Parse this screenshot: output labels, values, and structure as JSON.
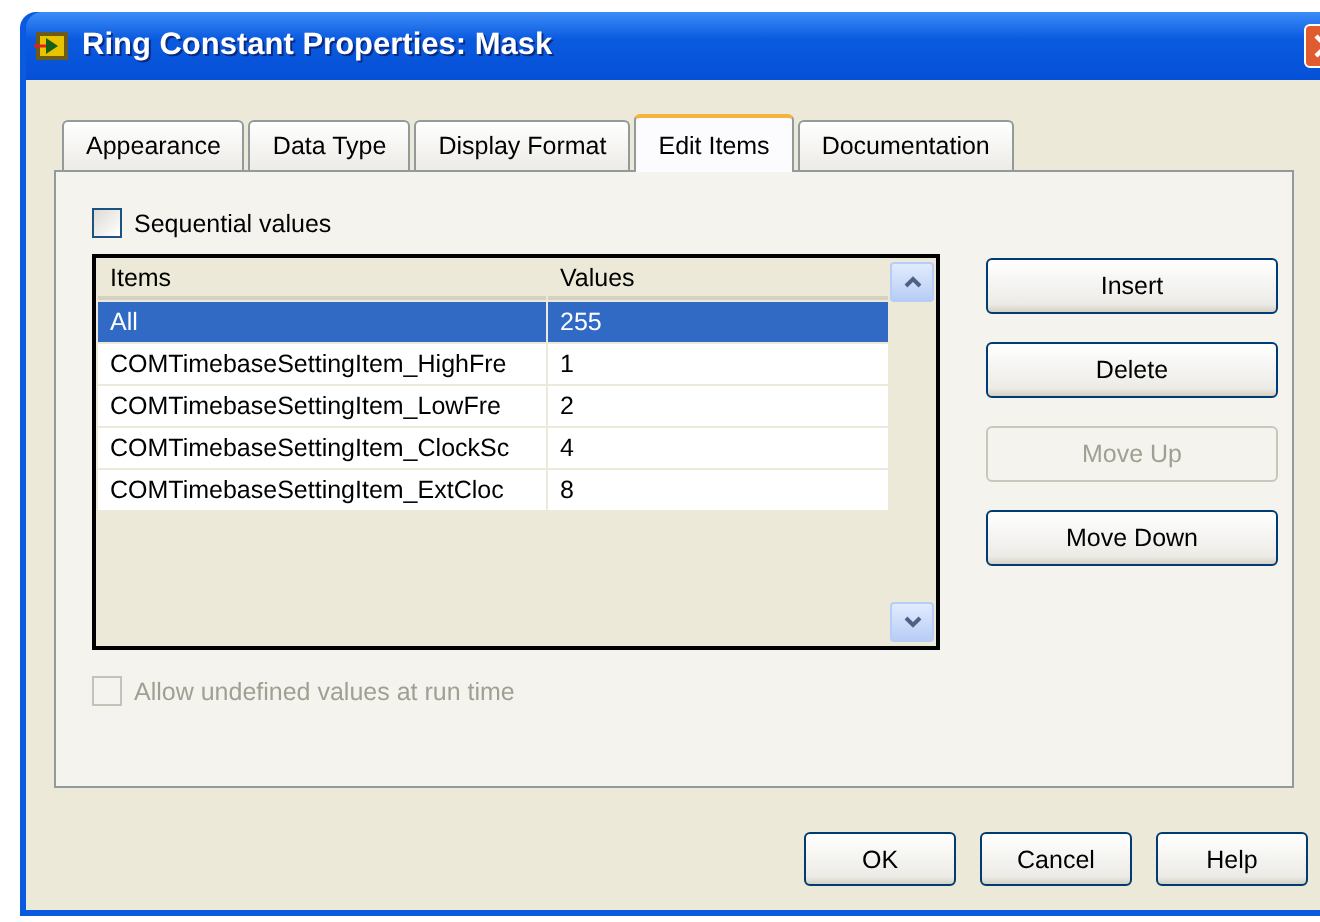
{
  "window": {
    "title": "Ring Constant Properties: Mask"
  },
  "tabs": [
    {
      "label": "Appearance",
      "selected": false
    },
    {
      "label": "Data Type",
      "selected": false
    },
    {
      "label": "Display Format",
      "selected": false
    },
    {
      "label": "Edit Items",
      "selected": true
    },
    {
      "label": "Documentation",
      "selected": false
    }
  ],
  "sequential_values": {
    "label": "Sequential values",
    "checked": false,
    "disabled": false
  },
  "table": {
    "columns": [
      "Items",
      "Values"
    ],
    "rows": [
      {
        "item": "All",
        "value": "255",
        "selected": true
      },
      {
        "item": "COMTimebaseSettingItem_HighFre",
        "value": "1",
        "selected": false
      },
      {
        "item": "COMTimebaseSettingItem_LowFre",
        "value": "2",
        "selected": false
      },
      {
        "item": "COMTimebaseSettingItem_ClockSc",
        "value": "4",
        "selected": false
      },
      {
        "item": "COMTimebaseSettingItem_ExtCloc",
        "value": "8",
        "selected": false
      }
    ]
  },
  "side_buttons": [
    {
      "label": "Insert",
      "disabled": false
    },
    {
      "label": "Delete",
      "disabled": false
    },
    {
      "label": "Move Up",
      "disabled": true
    },
    {
      "label": "Move Down",
      "disabled": false
    }
  ],
  "allow_undefined": {
    "label": "Allow undefined values at run time",
    "checked": false,
    "disabled": true
  },
  "dialog_buttons": [
    "OK",
    "Cancel",
    "Help"
  ]
}
